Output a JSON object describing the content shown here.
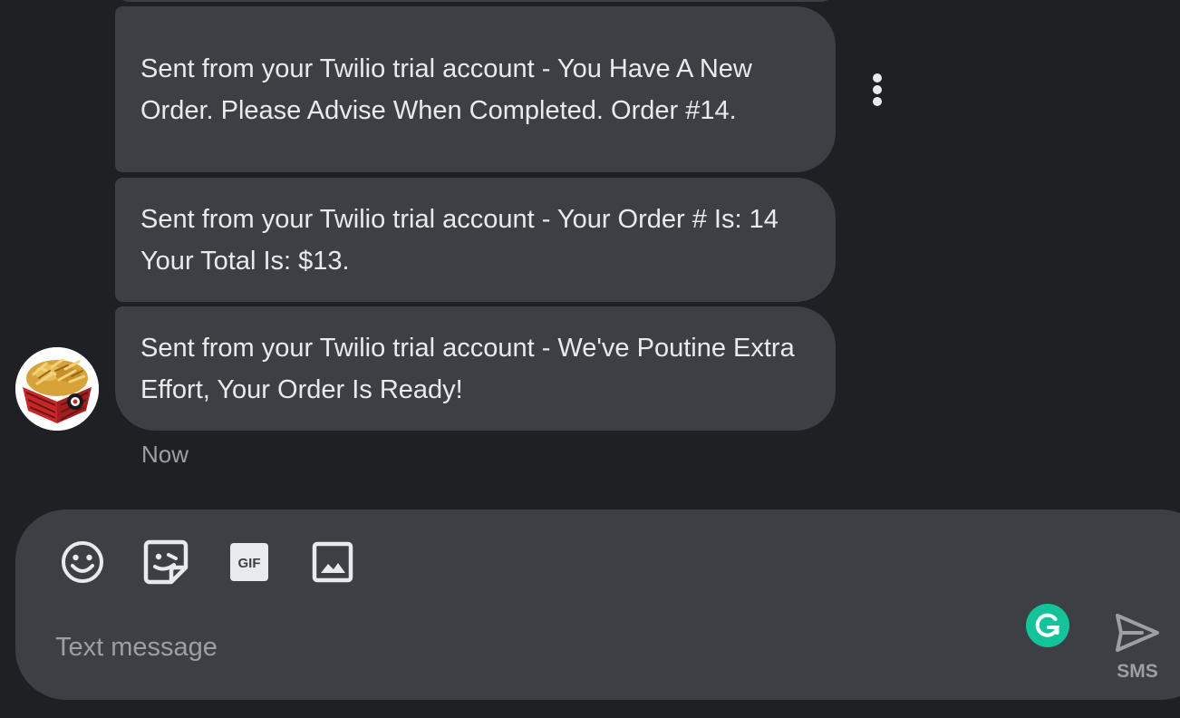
{
  "conversation": {
    "messages": [
      {
        "text": "Sent from your Twilio trial account - You Have A New Order. Please Advise When Completed. Order #14."
      },
      {
        "text": "Sent from your Twilio trial account - Your Order # Is: 14 Your Total Is: $13."
      },
      {
        "text": "Sent from your Twilio trial account - We've Poutine Extra Effort, Your Order Is Ready!"
      }
    ],
    "timestamp": "Now",
    "avatar_icon": "poutine-image",
    "menu_icon": "more-vert-icon"
  },
  "composer": {
    "placeholder": "Text message",
    "tools": [
      "emoji-icon",
      "sticker-icon",
      "gif-icon",
      "image-icon"
    ],
    "gif_badge_text": "GIF",
    "send_label": "SMS",
    "grammarly_icon": "grammarly-icon"
  },
  "colors": {
    "background": "#1f2023",
    "bubble": "#3c3f43",
    "text": "#e8eaed",
    "muted": "#9aa0a6",
    "grammarly": "#15c39a"
  }
}
